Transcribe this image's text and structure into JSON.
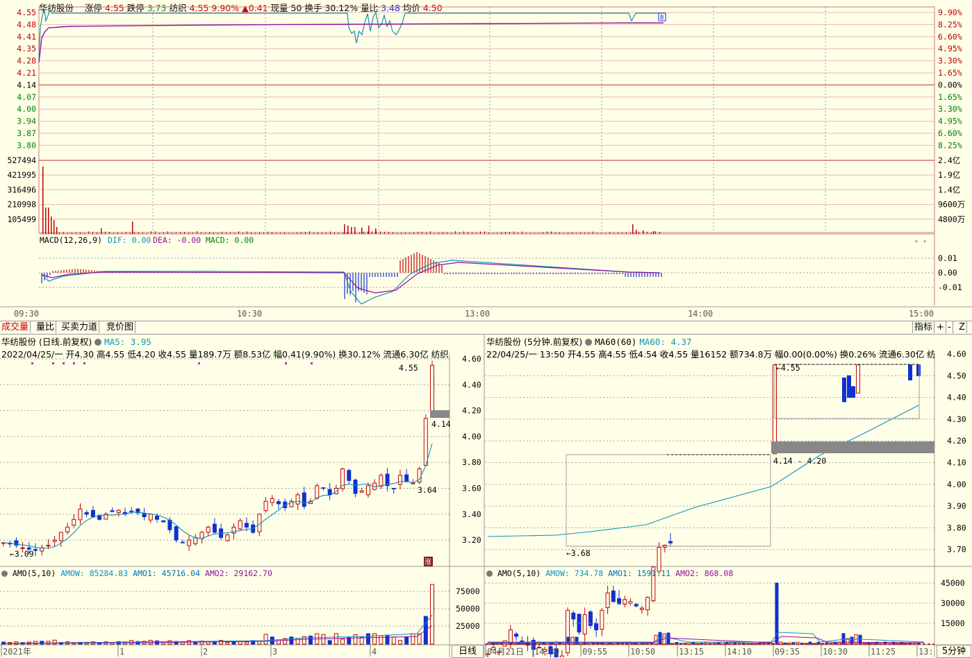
{
  "quote": {
    "name": "华纺股份",
    "limit_up_label": "涨停",
    "limit_up": "4.55",
    "limit_down_label": "跌停",
    "limit_down": "3.73",
    "sector": "纺织",
    "price": "4.55",
    "pct": "9.90%",
    "change": "▲0.41",
    "vol_label": "现量",
    "vol": "50",
    "turn_label": "换手",
    "turn": "30.12%",
    "ratio_label": "量比",
    "ratio": "3.48",
    "avg_label": "均价",
    "avg": "4.50"
  },
  "intraday": {
    "price_ticks": [
      "4.55",
      "4.48",
      "4.41",
      "4.35",
      "4.28",
      "4.21",
      "4.14",
      "4.07",
      "4.00",
      "3.94",
      "3.87",
      "3.80"
    ],
    "pct_ticks": [
      "9.90%",
      "8.25%",
      "6.60%",
      "4.95%",
      "3.30%",
      "1.65%",
      "0.00%",
      "1.65%",
      "3.30%",
      "4.95%",
      "6.60%",
      "8.25%"
    ],
    "vol_ticks": [
      "527494",
      "421995",
      "316496",
      "210998",
      "105499"
    ],
    "amt_ticks": [
      "2.4亿",
      "1.9亿",
      "1.4亿",
      "9600万",
      "4800万"
    ],
    "macd_label": "MACD(12,26,9)",
    "dif": "DIF: 0.00",
    "dea": "DEA: -0.00",
    "macd": "MACD: 0.00",
    "macd_ticks": [
      "0.01",
      "0.00",
      "-0.01"
    ],
    "time_axis": [
      "09:30",
      "10:30",
      "13:00",
      "14:00",
      "15:00"
    ],
    "buy_marker": "B"
  },
  "tabs": [
    "成交量",
    "量比",
    "买卖力道",
    "竞价图"
  ],
  "right_tabs": [
    "指标",
    "+",
    "-",
    "Z"
  ],
  "daily": {
    "title": "华纺股份 (日线.前复权)",
    "ma": "MA5: 3.95",
    "info": "2022/04/25/一 开4.30 高4.55 低4.20 收4.55 量189.7万 额8.53亿 幅0.41(9.90%) 换30.12% 流通6.30亿 纺织",
    "price_ticks": [
      "4.60",
      "4.40",
      "4.20",
      "4.00",
      "3.80",
      "3.60",
      "3.40",
      "3.20"
    ],
    "annotations": [
      "4.55",
      "4.14",
      "3.64",
      "3.09"
    ],
    "badge": "涨",
    "amo": "AMO(5,10)",
    "amow": "AMOW: 85284.83",
    "amo1": "AMO1: 45716.04",
    "amo2": "AMO2: 29162.70",
    "amo_ticks": [
      "75000",
      "50000",
      "25000"
    ],
    "x_axis": [
      "2021年",
      "1",
      "2",
      "3",
      "4"
    ],
    "period": "日线"
  },
  "min5": {
    "title": "华纺股份 (5分钟.前复权)",
    "ma": "MA60(60)",
    "ma_val": "MA60: 4.37",
    "info": "22/04/25/一 13:50 开4.55 高4.55 低4.54 收4.55 量16152 额734.8万 幅0.00(0.00%) 换0.26% 流通6.30亿 纺织",
    "price_ticks": [
      "4.60",
      "4.50",
      "4.40",
      "4.30",
      "4.20",
      "4.10",
      "4.00",
      "3.90",
      "3.80",
      "3.70"
    ],
    "annotations": [
      "4.55",
      "4.14 - 4.20",
      "3.68"
    ],
    "amo": "AMO(5,10)",
    "amow": "AMOW: 734.78",
    "amo1": "AMO1: 1591.11",
    "amo2": "AMO2: 868.08",
    "amo_ticks": [
      "45000",
      "30000",
      "15000"
    ],
    "x_axis": [
      "04月21日",
      "14:30",
      "09:55",
      "10:50",
      "13:15",
      "14:10",
      "09:35",
      "10:30",
      "11:25",
      "13:"
    ],
    "period": "5分钟"
  }
}
